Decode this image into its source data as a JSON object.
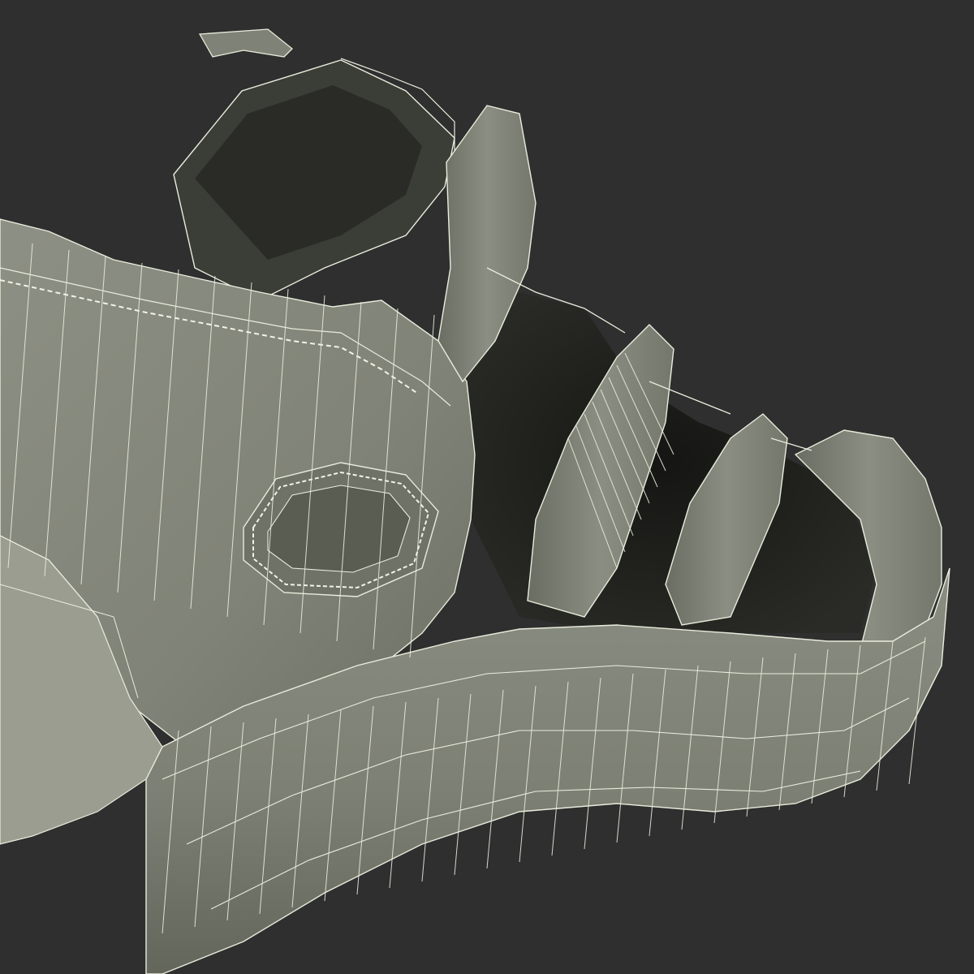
{
  "scene": {
    "subject": "sandal-wireframe-render",
    "colors": {
      "background": "#2f2f2f",
      "surface_light": "#8e9185",
      "surface_mid": "#7b7e72",
      "surface_dark": "#5d6055",
      "cavity": "#1f201c",
      "inner_shadow": "#3c3e37",
      "wire": "#e9ecdc",
      "stitch": "#f2f3e6"
    },
    "icons": [
      "sandal-sole",
      "heel-strap",
      "ankle-strap",
      "side-cutout",
      "toe-straps",
      "stitching",
      "wireframe-mesh"
    ]
  }
}
